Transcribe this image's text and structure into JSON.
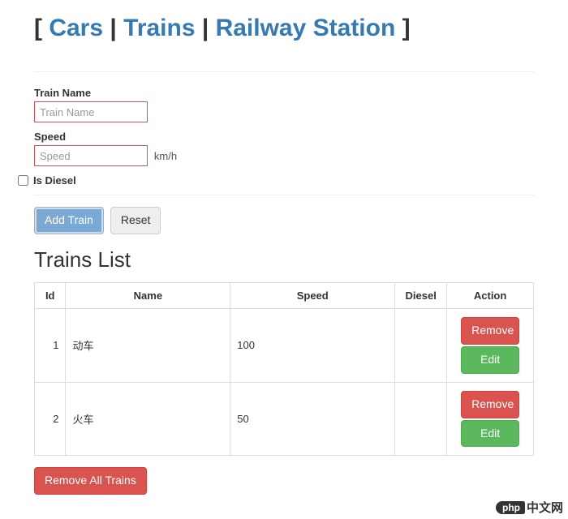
{
  "header": {
    "open_bracket": "[ ",
    "close_bracket": " ]",
    "sep": " | ",
    "links": [
      "Cars",
      "Trains",
      "Railway Station"
    ]
  },
  "form": {
    "train_name_label": "Train Name",
    "train_name_placeholder": "Train Name",
    "speed_label": "Speed",
    "speed_placeholder": "Speed",
    "speed_unit": "km/h",
    "is_diesel_label": "Is Diesel",
    "add_button": "Add Train",
    "reset_button": "Reset"
  },
  "list": {
    "title": "Trains List",
    "columns": {
      "id": "Id",
      "name": "Name",
      "speed": "Speed",
      "diesel": "Diesel",
      "action": "Action"
    },
    "rows": [
      {
        "id": "1",
        "name": "动车",
        "speed": "100",
        "diesel": ""
      },
      {
        "id": "2",
        "name": "火车",
        "speed": "50",
        "diesel": ""
      }
    ],
    "remove_label": "Remove",
    "edit_label": "Edit",
    "remove_all": "Remove All Trains"
  },
  "watermark": {
    "badge": "php",
    "text": "中文网"
  }
}
